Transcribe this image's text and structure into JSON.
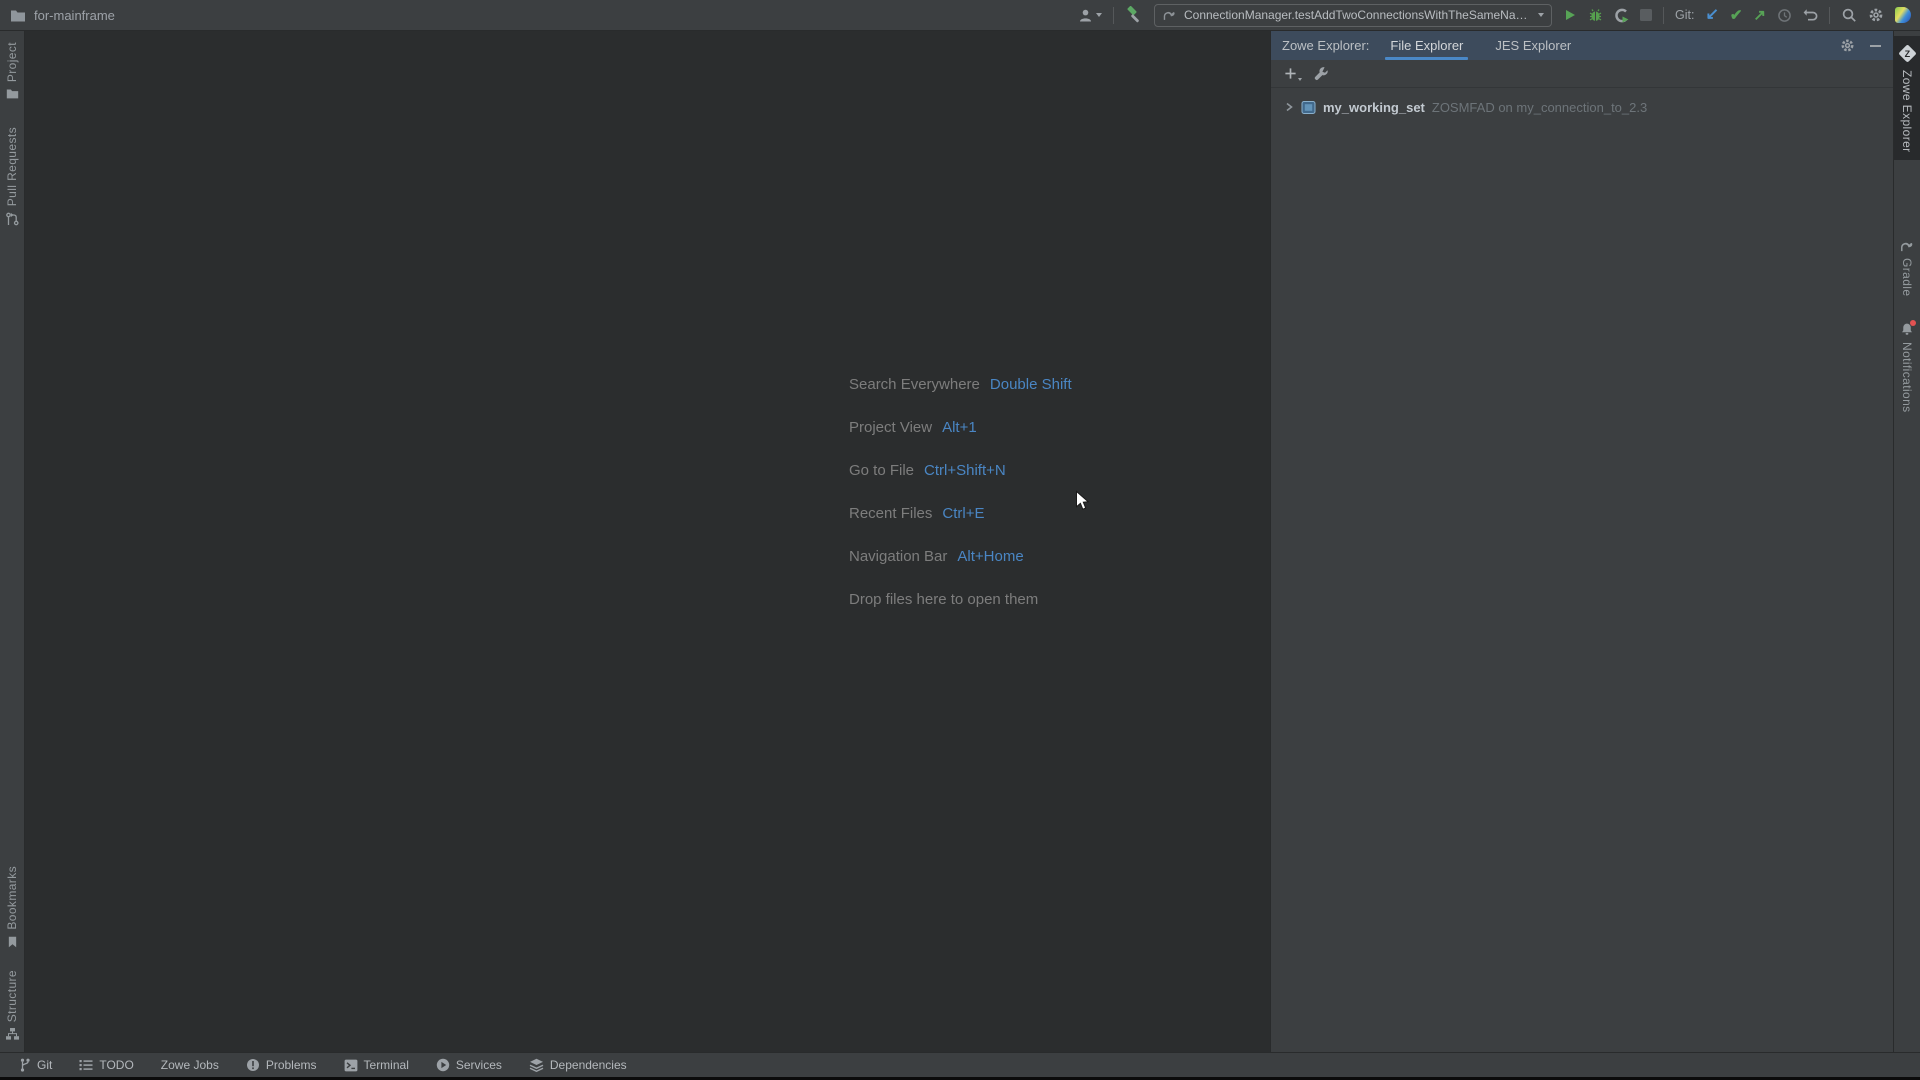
{
  "colors": {
    "accent_blue": "#4a88c7",
    "shortcut_key_blue": "#4a86c4",
    "run_green": "#57a356",
    "git_update_blue": "#4a8fd0",
    "notification_red": "#e35252",
    "panel_header_bg": "#3d4b5c",
    "toolbar_bg": "#3c3f41",
    "editor_bg": "#2b2d2e"
  },
  "titlebar": {
    "project_name": "for-mainframe",
    "run_config": "ConnectionManager.testAddTwoConnectionsWithTheSameName",
    "git_label": "Git:",
    "glyphs": {
      "update": "↙",
      "commit": "✔",
      "push": "↗"
    }
  },
  "left_stripe": {
    "items": [
      {
        "label": "Project",
        "icon": "folder-icon"
      },
      {
        "label": "Pull Requests",
        "icon": "pull-request-icon"
      },
      {
        "label": "Bookmarks",
        "icon": "bookmark-icon"
      },
      {
        "label": "Structure",
        "icon": "structure-icon"
      }
    ]
  },
  "right_stripe": {
    "zowe_glyph": "Z",
    "items": [
      {
        "label": "Zowe Explorer",
        "icon": "zowe-icon",
        "selected": true
      },
      {
        "label": "Gradle",
        "icon": "gradle-icon",
        "selected": false
      },
      {
        "label": "Notifications",
        "icon": "bell-icon",
        "selected": false
      }
    ]
  },
  "editor": {
    "shortcuts": [
      {
        "label": "Search Everywhere",
        "keys": "Double Shift"
      },
      {
        "label": "Project View",
        "keys": "Alt+1"
      },
      {
        "label": "Go to File",
        "keys": "Ctrl+Shift+N"
      },
      {
        "label": "Recent Files",
        "keys": "Ctrl+E"
      },
      {
        "label": "Navigation Bar",
        "keys": "Alt+Home"
      }
    ],
    "drop_hint": "Drop files here to open them"
  },
  "panel": {
    "title": "Zowe Explorer:",
    "tabs": [
      {
        "label": "File Explorer",
        "selected": true
      },
      {
        "label": "JES Explorer",
        "selected": false
      }
    ],
    "tree": [
      {
        "name": "my_working_set",
        "detail": "ZOSMFAD on my_connection_to_2.3"
      }
    ]
  },
  "status_bar": {
    "items": [
      {
        "label": "Git",
        "icon": "git-branch-icon"
      },
      {
        "label": "TODO",
        "icon": "todo-icon"
      },
      {
        "label": "Zowe Jobs",
        "icon": ""
      },
      {
        "label": "Problems",
        "icon": "problems-icon"
      },
      {
        "label": "Terminal",
        "icon": "terminal-icon"
      },
      {
        "label": "Services",
        "icon": "services-icon"
      },
      {
        "label": "Dependencies",
        "icon": "dependencies-icon"
      }
    ]
  }
}
